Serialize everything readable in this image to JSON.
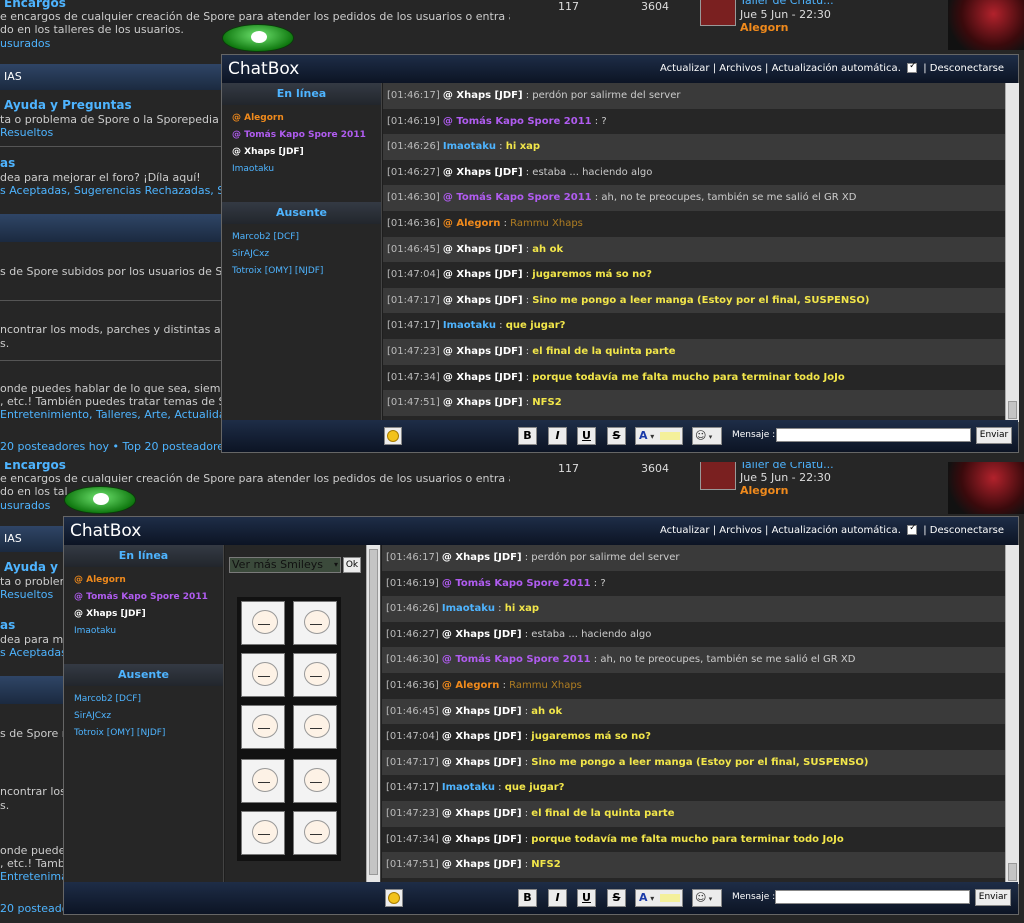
{
  "forum": {
    "encargos_title": "Encargos",
    "encargos_desc1": "e encargos de cualquier creación de Spore para atender los pedidos de los usuarios o entra aquí para",
    "encargos_desc2": "do en los talleres de los usuarios.",
    "encargos_sub": "usurados",
    "encargos_topics": "117",
    "encargos_posts": "3604",
    "last_topic": "Taller de Criatu...",
    "last_date": "Jue 5 Jun - 22:30",
    "last_user": "Alegorn",
    "section_header": "IAS",
    "ayuda_title": "Ayuda y Preguntas",
    "ayuda_desc": "ta o problema de Spore o la Sporepedia 2, ¡ac",
    "ayuda_sub": "Resueltos",
    "sugerencias_title": "as",
    "sugerencias_desc": "dea para mejorar el foro? ¡Díla aquí!",
    "sugerencias_subs": "s Aceptadas, Sugerencias Rechazadas, Su",
    "subidos_desc": "s de Spore subidos por los usuarios de Spore",
    "mods_desc1": "ncontrar los mods, parches y distintas aplicac",
    "mods_desc2": "s.",
    "off_desc1": "onde puedes hablar de lo que sea, siempre y c",
    "off_desc2": ", etc.! También puedes tratar temas de Spore.",
    "off_subs": "Entretenimiento, Talleres, Arte, Actualidad",
    "bottom_stats": "20 posteadores hoy • Top 20 posteadores de",
    "p2_desc1": "e encargos de cualquier creación de Spore para atender los pedidos de los usuarios o entra aquí para",
    "p2_desc2": "do en los tal",
    "p2_ayuda_title": "Ayuda y",
    "p2_ayuda_desc": "ta o problema",
    "p2_sug_desc": "dea para me",
    "p2_sug_subs": "s AceptadasSu",
    "p2_subidos": "s de Spore re",
    "p2_mods1": "ncontrar loso",
    "p2_mods2": "s.",
    "p2_off1": "onde puedey c",
    "p2_off2": ", etc.! Tambe.",
    "p2_off_subs": "Entretenimac",
    "p2_bottom": "20 posteado"
  },
  "chatbox": {
    "title": "ChatBox",
    "links": "Actualizar | Archivos | Actualización automática.",
    "disconnect": "| Desconectarse",
    "online_header": "En línea",
    "away_header": "Ausente",
    "online_users": [
      {
        "name": "@ Alegorn",
        "color": "#f08a1c"
      },
      {
        "name": "@ Tomás Kapo Spore 2011",
        "color": "#b05cf0"
      },
      {
        "name": "@ Xhaps [JDF]",
        "color": "#ffffff"
      },
      {
        "name": "Imaotaku",
        "color": "#4eb4ff"
      }
    ],
    "away_users": [
      "Marcob2 [DCF]",
      "SirAJCxz",
      "Totroix [OMY] [NJDF]"
    ],
    "messages": [
      {
        "time": "[01:46:17]",
        "user": "@ Xhaps [JDF]",
        "ucolor": "#ffffff",
        "sep": " : ",
        "text": "perdón por salirme del server",
        "tcolor": "#cccccc",
        "tbold": false
      },
      {
        "time": "[01:46:19]",
        "user": "@ Tomás Kapo Spore 2011",
        "ucolor": "#b05cf0",
        "sep": " : ",
        "text": "?",
        "tcolor": "#cccccc",
        "tbold": false
      },
      {
        "time": "[01:46:26]",
        "user": "Imaotaku",
        "ucolor": "#4eb4ff",
        "sep": " : ",
        "text": "hi xap",
        "tcolor": "#f2e64a",
        "tbold": true
      },
      {
        "time": "[01:46:27]",
        "user": "@ Xhaps [JDF]",
        "ucolor": "#ffffff",
        "sep": " : ",
        "text": "estaba ... haciendo algo",
        "tcolor": "#cccccc",
        "tbold": false
      },
      {
        "time": "[01:46:30]",
        "user": "@ Tomás Kapo Spore 2011",
        "ucolor": "#b05cf0",
        "sep": " : ",
        "text": "ah, no te preocupes, también se me salió el GR XD",
        "tcolor": "#cccccc",
        "tbold": false
      },
      {
        "time": "[01:46:36]",
        "user": "@ Alegorn",
        "ucolor": "#f08a1c",
        "sep": " : ",
        "text": "Rammu Xhaps",
        "tcolor": "#b07e22",
        "tbold": false
      },
      {
        "time": "[01:46:45]",
        "user": "@ Xhaps [JDF]",
        "ucolor": "#ffffff",
        "sep": " : ",
        "text": "ah ok",
        "tcolor": "#f2e64a",
        "tbold": true
      },
      {
        "time": "[01:47:04]",
        "user": "@ Xhaps [JDF]",
        "ucolor": "#ffffff",
        "sep": " : ",
        "text": "jugaremos má so no?",
        "tcolor": "#f2e64a",
        "tbold": true
      },
      {
        "time": "[01:47:17]",
        "user": "@ Xhaps [JDF]",
        "ucolor": "#ffffff",
        "sep": " : ",
        "text": "Sino me pongo a leer manga (Estoy por el final, SUSPENSO)",
        "tcolor": "#f2e64a",
        "tbold": true
      },
      {
        "time": "[01:47:17]",
        "user": "Imaotaku",
        "ucolor": "#4eb4ff",
        "sep": " : ",
        "text": "que jugar?",
        "tcolor": "#f2e64a",
        "tbold": true
      },
      {
        "time": "[01:47:23]",
        "user": "@ Xhaps [JDF]",
        "ucolor": "#ffffff",
        "sep": " : ",
        "text": "el final de la quinta parte",
        "tcolor": "#f2e64a",
        "tbold": true
      },
      {
        "time": "[01:47:34]",
        "user": "@ Xhaps [JDF]",
        "ucolor": "#ffffff",
        "sep": " : ",
        "text": "porque todavía me falta mucho para terminar todo JoJo",
        "tcolor": "#f2e64a",
        "tbold": true
      },
      {
        "time": "[01:47:51]",
        "user": "@ Xhaps [JDF]",
        "ucolor": "#ffffff",
        "sep": " : ",
        "text": "NFS2",
        "tcolor": "#f2e64a",
        "tbold": true
      }
    ],
    "toolbar": {
      "bold": "B",
      "italic": "I",
      "underline": "U",
      "strike": "S",
      "color": "A",
      "message_label": "Mensaje :",
      "send": "Enviar"
    },
    "smileys": {
      "select_value": "Ver más Smileys",
      "ok": "Ok",
      "icons": [
        "smiley-face-icon",
        "smiley-face-icon",
        "smiley-face-icon",
        "smiley-face-icon",
        "smiley-face-icon",
        "smiley-face-icon",
        "smiley-face-icon",
        "smiley-face-icon",
        "smiley-face-icon",
        "smiley-face-icon"
      ]
    }
  }
}
